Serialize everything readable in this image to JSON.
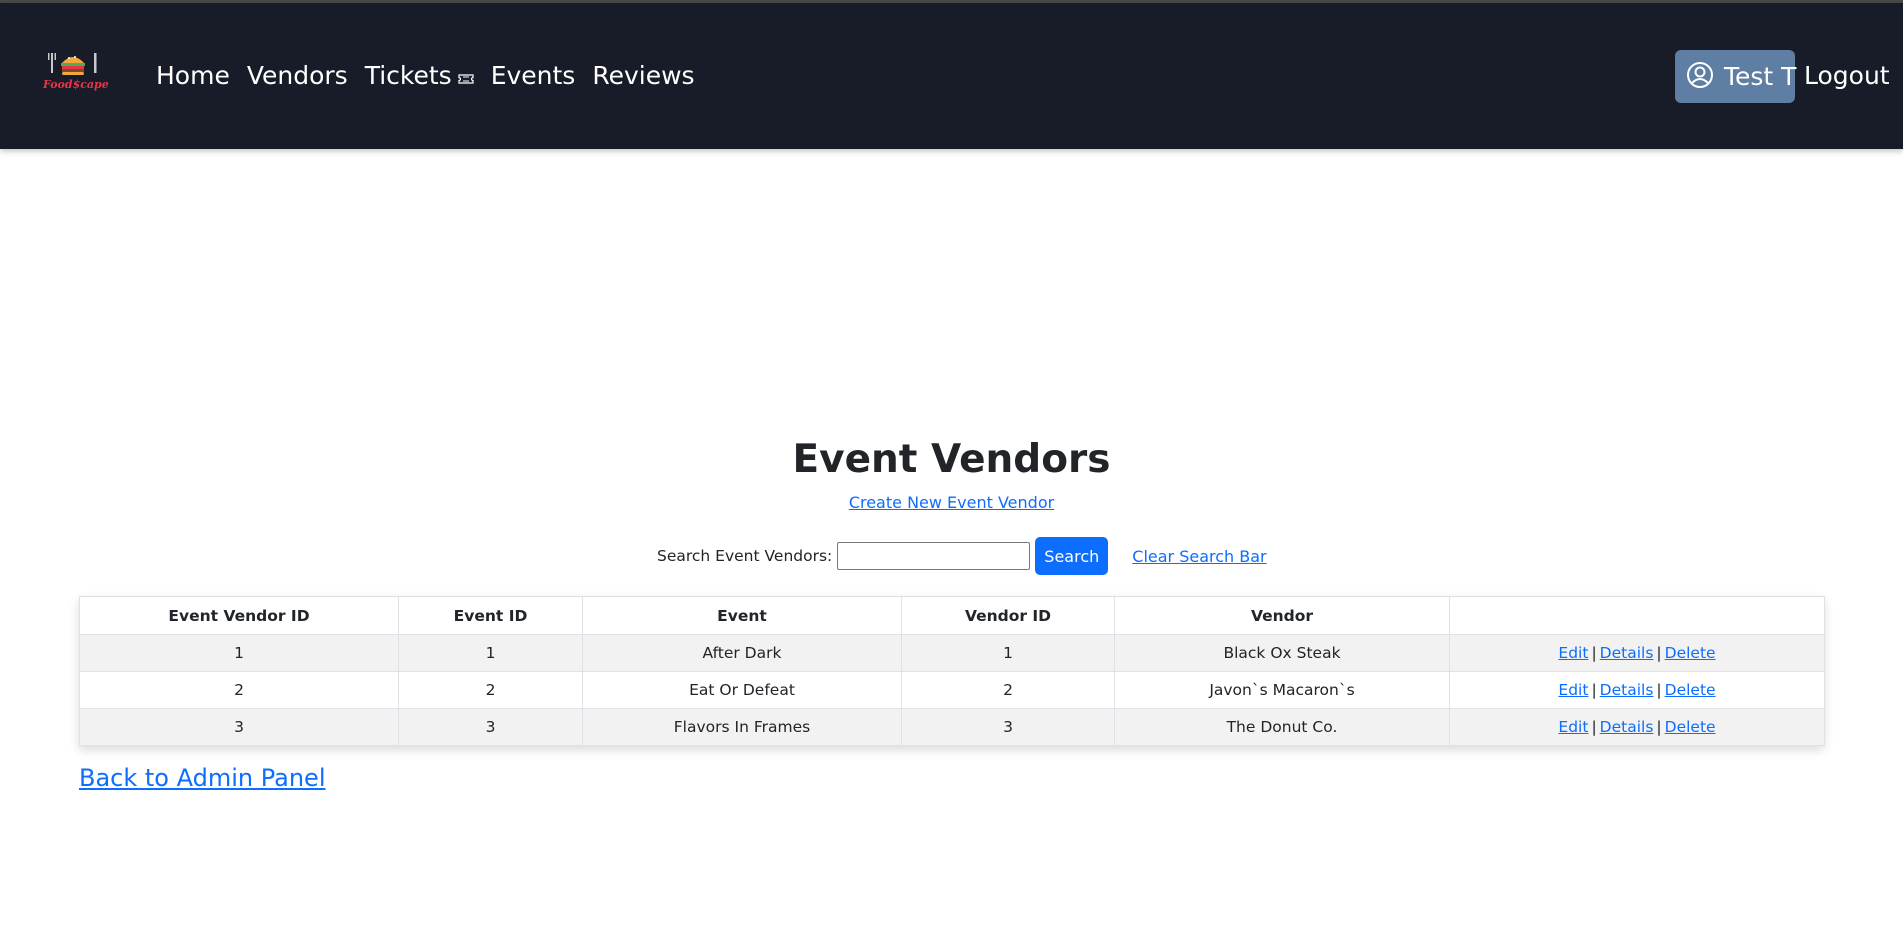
{
  "nav": {
    "brand": "Food$cape",
    "links": [
      "Home",
      "Vendors",
      "Tickets",
      "Events",
      "Reviews"
    ],
    "user_name": "Test T",
    "logout_label": "Logout"
  },
  "page": {
    "title": "Event Vendors",
    "create_link": "Create New Event Vendor"
  },
  "search": {
    "label": "Search Event Vendors:",
    "value": "",
    "placeholder": "",
    "button_label": "Search",
    "clear_label": "Clear Search Bar"
  },
  "table": {
    "columns": [
      "Event Vendor ID",
      "Event ID",
      "Event",
      "Vendor ID",
      "Vendor",
      ""
    ],
    "rows": [
      {
        "event_vendor_id": "1",
        "event_id": "1",
        "event": "After Dark",
        "vendor_id": "1",
        "vendor": "Black Ox Steak"
      },
      {
        "event_vendor_id": "2",
        "event_id": "2",
        "event": "Eat Or Defeat",
        "vendor_id": "2",
        "vendor": "Javon`s Macaron`s"
      },
      {
        "event_vendor_id": "3",
        "event_id": "3",
        "event": "Flavors In Frames",
        "vendor_id": "3",
        "vendor": "The Donut Co."
      }
    ],
    "actions": {
      "edit": "Edit",
      "details": "Details",
      "delete": "Delete",
      "separator": "|"
    }
  },
  "back_link": "Back to Admin Panel",
  "colors": {
    "navbar": "#171c28",
    "user_badge": "#5f7ea3",
    "link": "#0d6efd",
    "button": "#0d6efd",
    "brand": "#e8334a"
  },
  "icons": {
    "user": "user-circle-icon",
    "ticket": "ticket-icon",
    "logo": "burger-logo-icon"
  }
}
